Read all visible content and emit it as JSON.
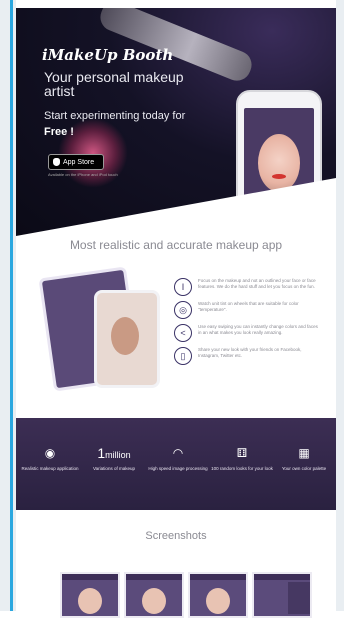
{
  "hero": {
    "brand": "iMakeUp Booth",
    "tagline_line1": "Your personal makeup artist",
    "tagline_line2": "Start experimenting today for",
    "tagline_free": "Free !",
    "app_store_label": "App Store",
    "app_store_caption": "Available on the iPhone and iPod touch"
  },
  "section2": {
    "title": "Most realistic and accurate makeup app",
    "features": [
      {
        "icon": "brush-icon",
        "glyph": "I",
        "text": "Focus on the makeup and not an outlined your face or face features. We do the hard stuff and let you focus on the fun."
      },
      {
        "icon": "color-wheel-icon",
        "glyph": "◎",
        "text": "Watch unit tint on wheels that are suitable for color \"temperature\"."
      },
      {
        "icon": "share-icon",
        "glyph": "<",
        "text": "Use easy swiping you can instantly change colors and faces in an what makes you look really amazing."
      },
      {
        "icon": "phone-icon",
        "glyph": "▯",
        "text": "Share your new look with your friends on Facebook, Instagram, Twitter etc."
      }
    ]
  },
  "stats": [
    {
      "icon": "eye-icon",
      "glyph": "◉",
      "number": "",
      "label": "Realistic makeup application"
    },
    {
      "icon": "",
      "glyph": "",
      "number": "1",
      "number_suffix": "million",
      "label": "Variations of makeup"
    },
    {
      "icon": "gauge-icon",
      "glyph": "◠",
      "number": "",
      "label": "High speed image processing"
    },
    {
      "icon": "dice-icon",
      "glyph": "⚅",
      "number": "",
      "label": "100 random looks for your look"
    },
    {
      "icon": "palette-icon",
      "glyph": "▦",
      "number": "",
      "label": "Your own color palette"
    }
  ],
  "screenshots": {
    "title": "Screenshots",
    "count": 4
  }
}
